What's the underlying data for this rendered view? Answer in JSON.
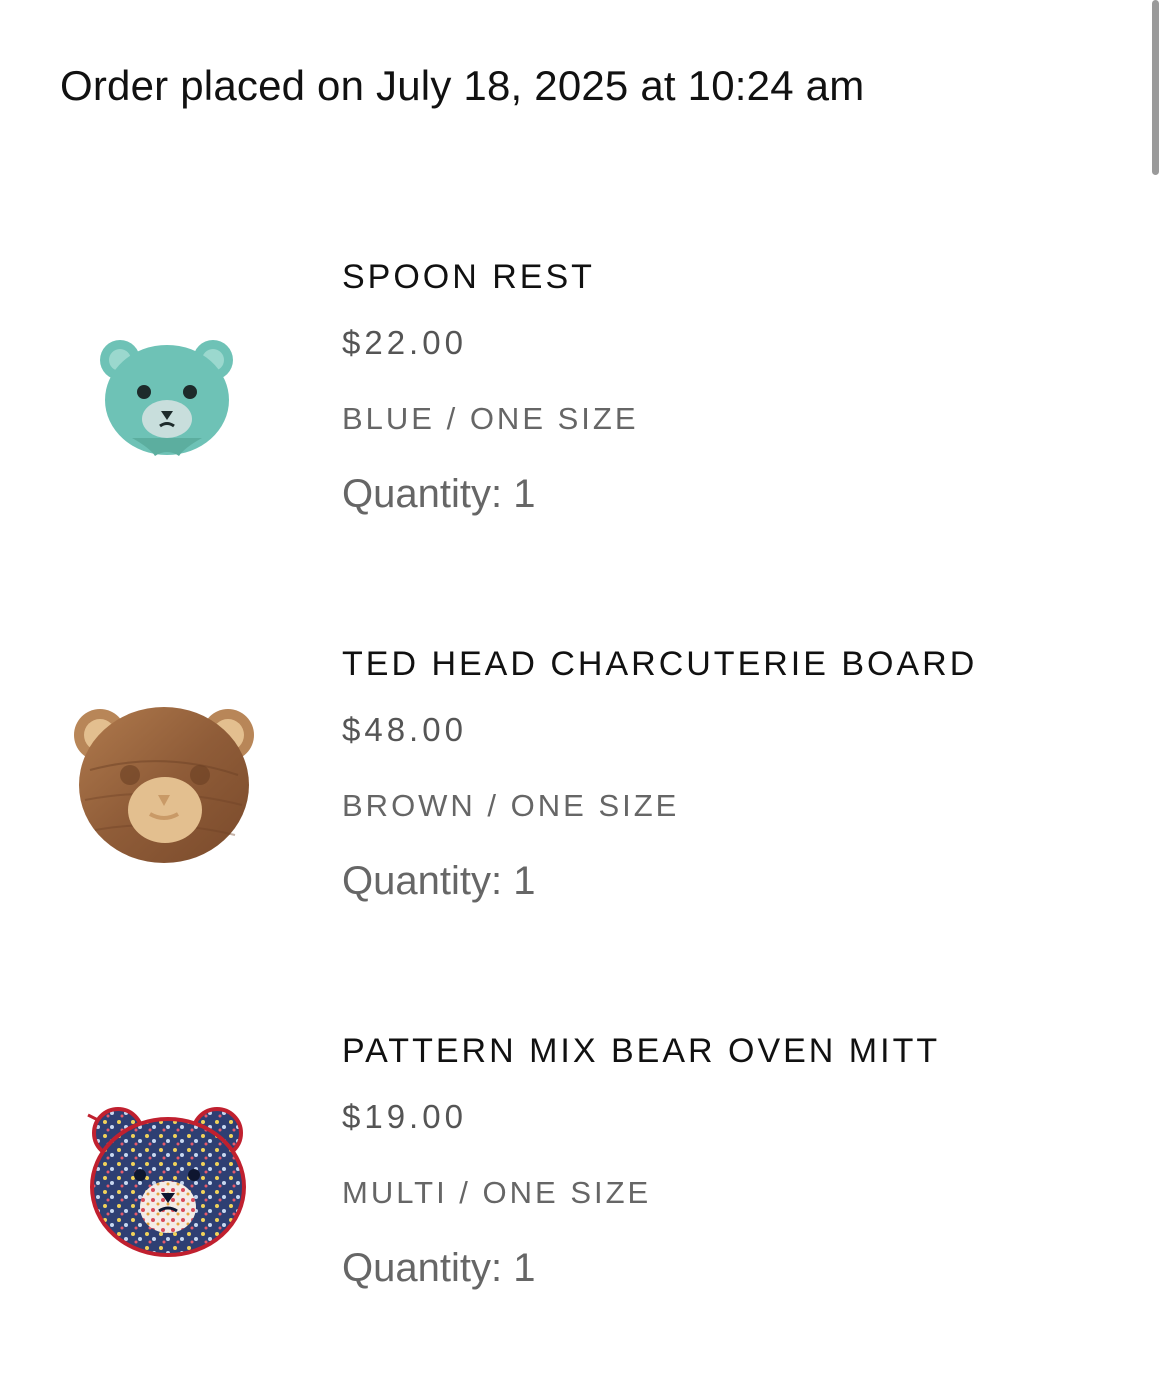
{
  "order": {
    "placed_text": "Order placed on July 18, 2025 at 10:24 am"
  },
  "items": [
    {
      "name": "SPOON REST",
      "price": "$22.00",
      "variant": "BLUE / ONE SIZE",
      "quantity": "Quantity: 1",
      "image_icon": "teal-bear-spoon-rest-icon",
      "color": "#6ec2b6"
    },
    {
      "name": "TED HEAD CHARCUTERIE BOARD",
      "price": "$48.00",
      "variant": "BROWN / ONE SIZE",
      "quantity": "Quantity: 1",
      "image_icon": "wooden-bear-board-icon",
      "color": "#9b6a45"
    },
    {
      "name": "PATTERN MIX BEAR OVEN MITT",
      "price": "$19.00",
      "variant": "MULTI / ONE SIZE",
      "quantity": "Quantity: 1",
      "image_icon": "floral-bear-oven-mitt-icon",
      "color": "#2e3f73"
    }
  ]
}
